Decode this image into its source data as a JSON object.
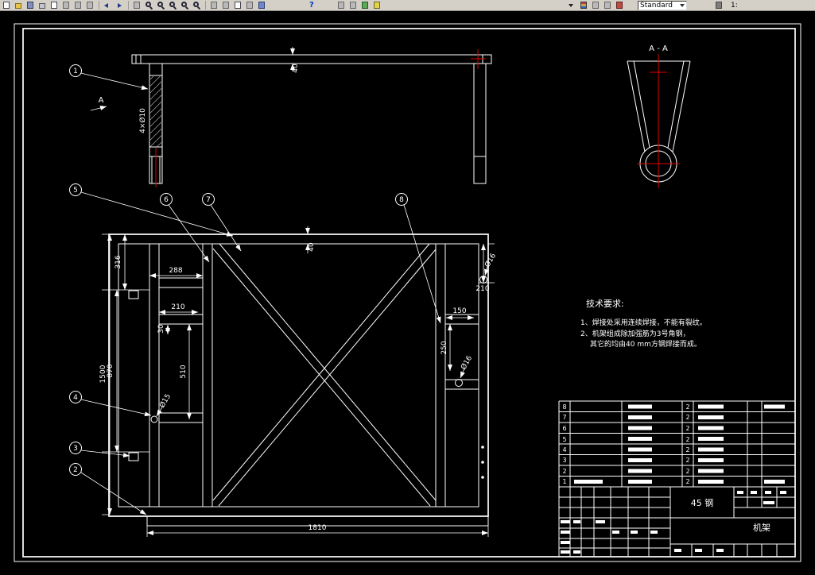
{
  "toolbar": {
    "style_value": "Standard",
    "right_label": "1:",
    "icons": [
      "new-file",
      "open-file",
      "save",
      "print",
      "print-preview",
      "cut",
      "copy",
      "paste",
      "undo",
      "redo",
      "pan",
      "zoom-realtime",
      "zoom-window",
      "zoom-previous",
      "zoom-in",
      "zoom-out",
      "distance",
      "area",
      "list",
      "locate-point",
      "properties",
      "help",
      "redraw",
      "named-views",
      "color-control",
      "swatches",
      "toolbar-dropdown",
      "layers",
      "layer-control",
      "linetype",
      "pen-settings",
      "customize-tool"
    ]
  },
  "drawing": {
    "section": {
      "title": "A - A",
      "mark": "A"
    },
    "callouts": {
      "b1": "1",
      "b2": "2",
      "b3": "3",
      "b4": "4",
      "b5": "5",
      "b6": "6",
      "b7": "7",
      "b8": "8"
    },
    "dims": {
      "top_rail_40": "40",
      "holes_4x10": "4×Ø10",
      "main_rail_40": "40",
      "left_316": "316",
      "left_870": "870",
      "left_1500": "1500",
      "panel_288": "288",
      "panel_210": "210",
      "panel_30": "30",
      "panel_510": "510",
      "hole_15": "Ø15",
      "right_hole_16_top": "Ø16",
      "right_210": "210",
      "right_150": "150",
      "right_250": "250",
      "right_hole_16_bottom": "Ø16",
      "overall_1810": "1810"
    },
    "notes": {
      "title": "技术要求:",
      "line1": "1、焊接处采用连续焊接，不能有裂纹。",
      "line2": "2、机架组成除加强筋为3号角钢，",
      "line3": "其它的均由40 mm方钢焊接而成。"
    },
    "parts_list": {
      "rows": [
        {
          "no": "8",
          "qty": "2"
        },
        {
          "no": "7",
          "qty": "2"
        },
        {
          "no": "6",
          "qty": "2"
        },
        {
          "no": "5",
          "qty": "2"
        },
        {
          "no": "4",
          "qty": "2"
        },
        {
          "no": "3",
          "qty": "2"
        },
        {
          "no": "2",
          "qty": "2"
        },
        {
          "no": "1",
          "qty": "2"
        }
      ]
    },
    "title_block": {
      "material": "45 钢",
      "part_name": "机架"
    }
  }
}
